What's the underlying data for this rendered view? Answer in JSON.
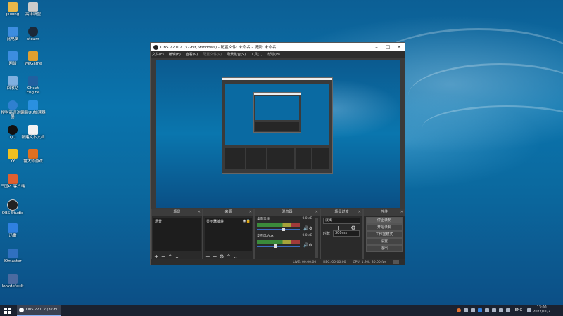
{
  "desktop_icons": [
    {
      "id": "jiuxing",
      "label": "Jiuxing",
      "color": "#e8b84a"
    },
    {
      "id": "gaoxian",
      "label": "高维新型",
      "color": "#cccccc"
    },
    {
      "id": "computer",
      "label": "此电脑",
      "color": "#3d8de0"
    },
    {
      "id": "steam",
      "label": "steam",
      "color": "#1b2838"
    },
    {
      "id": "network",
      "label": "网络",
      "color": "#3d8de0"
    },
    {
      "id": "wegame",
      "label": "WeGame",
      "color": "#e0a030"
    },
    {
      "id": "recycle",
      "label": "回收站",
      "color": "#7fb0e0"
    },
    {
      "id": "cheatengine",
      "label": "Cheat Engine",
      "color": "#2060a0"
    },
    {
      "id": "sogou",
      "label": "搜狗高速浏览器",
      "color": "#2f80d0"
    },
    {
      "id": "uu",
      "label": "网易UU加速器",
      "color": "#2a90e0"
    },
    {
      "id": "qq",
      "label": "QQ",
      "color": "#111111"
    },
    {
      "id": "newtxt",
      "label": "新建文本文档",
      "color": "#f2f2f2"
    },
    {
      "id": "yy",
      "label": "YY",
      "color": "#f0c020"
    },
    {
      "id": "ludashi",
      "label": "鲁大师游戏",
      "color": "#e07020"
    },
    {
      "id": "sanguo",
      "label": "三国PC客户端",
      "color": "#e06030"
    },
    {
      "id": "obs",
      "label": "OBS Studio",
      "color": "#222222"
    },
    {
      "id": "xunlei",
      "label": "迅雷",
      "color": "#2f80e0"
    },
    {
      "id": "iqmaster",
      "label": "IOmaster",
      "color": "#3070c0"
    },
    {
      "id": "lookdefault",
      "label": "lookdefault",
      "color": "#4a6aa0"
    }
  ],
  "obs": {
    "title": "OBS 22.0.2 (32-bit, windows) - 配置文件: 未命名 - 场景: 未命名",
    "menu": [
      "文件(F)",
      "编辑(E)",
      "查看(V)",
      "配置文件(P)",
      "场景集合(S)",
      "工具(T)",
      "帮助(H)"
    ],
    "docks": {
      "scenes": {
        "title": "场景",
        "item": "场景"
      },
      "sources": {
        "title": "来源",
        "item": "显示器捕获"
      },
      "mixer": {
        "title": "混音器",
        "tracks": [
          {
            "name": "桌面音频",
            "db": "0.0 dB",
            "level": 0.6
          },
          {
            "name": "麦克风/Aux",
            "db": "0.0 dB",
            "level": 0.4
          }
        ]
      },
      "transitions": {
        "title": "场景过渡",
        "type": "淡出",
        "duration_label": "时长",
        "duration": "300ms"
      },
      "controls": {
        "title": "控件",
        "buttons": [
          "停止录制",
          "开始录制",
          "工作室模式",
          "设置",
          "退出"
        ]
      }
    },
    "status": {
      "live": "LIVE: 00:00:00",
      "rec": "REC: 00:00:00",
      "cpu": "CPU: 1.9%, 30.00 fps"
    }
  },
  "taskbar": {
    "task_label": "OBS 22.0.2 (32-bi...",
    "lang": "ENG",
    "time": "13:00",
    "date": "2022/11/2"
  }
}
